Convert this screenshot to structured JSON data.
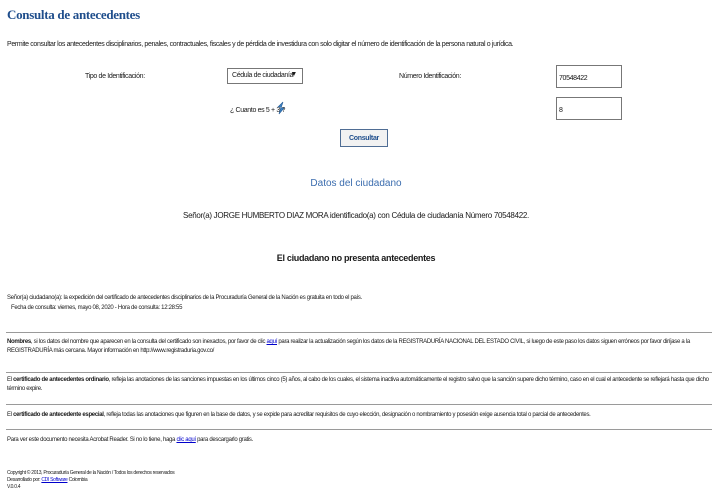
{
  "header": {
    "title": "Consulta de antecedentes",
    "description": "Permite consultar los antecedentes disciplinarios, penales, contractuales, fiscales y de pérdida de investidura con solo digitar el número de identificación de la persona natural o jurídica."
  },
  "form": {
    "tipo_label": "Tipo de Identificación:",
    "tipo_value": "Cédula de ciudadanía",
    "numero_label": "Número Identificación:",
    "numero_value": "70548422",
    "captcha_question": "¿ Cuanto es 5 + 3 ?",
    "captcha_answer": "8",
    "submit_label": "Consultar"
  },
  "result": {
    "section_title": "Datos del ciudadano",
    "citizen_line": "Señor(a)  JORGE HUMBERTO DIAZ MORA identificado(a) con Cédula de ciudadanía Número 70548422.",
    "status": "El ciudadano no presenta antecedentes"
  },
  "notice": {
    "line1": "Señor(a) ciudadano(a): la expedición del certificado de antecedentes disciplinarios de la Procuraduría General de la Nación es gratuita en todo el país.",
    "line2": "Fecha de consulta: viernes, mayo 08, 2020 - Hora de consulta: 12:28:55"
  },
  "info": {
    "nombres_bold": "Nombres",
    "nombres_pre": ", si los datos del nombre que aparecen en la consulta del certificado son inexactos, por favor de clic ",
    "nombres_link": "aquí",
    "nombres_post": " para realizar la actualización según los datos de la REGISTRADURÍA NACIONAL DEL ESTADO CIVIL, si luego de este paso los datos siguen erróneos por favor diríjase a la REGISTRADURÍA más cercana. Mayor información en http://www.registraduria.gov.co/",
    "ordinario_pre": "El ",
    "ordinario_bold": "certificado de antecedentes ordinario",
    "ordinario_post": ", refleja las anotaciones de las sanciones impuestas en los últimos cinco (5) años, al cabo de los cuales, el sistema inactiva automáticamente el registro salvo que la sanción supere dicho término, caso en el cual el antecedente se reflejará hasta que dicho término expire.",
    "especial_pre": "El ",
    "especial_bold": "certificado de antecedente especial",
    "especial_post": ", refleja todas las anotaciones que figuren en la base de datos, y se expide para acreditar requisitos de cuyo elección, designación o nombramiento y posesión exige ausencia total o parcial de antecedentes.",
    "acrobat_pre": "Para ver este documento necesita Acrobat Reader. Si no lo tiene, haga ",
    "acrobat_link": "clic aquí",
    "acrobat_post": " para descargarlo gratis."
  },
  "footer": {
    "copyright": "Copyright © 2013, Procuraduría General de la Nación / Todos los derechos reservados",
    "developed_pre": "Desarrollado por: ",
    "developed_link": "CDI Software",
    "developed_post": " Colombia",
    "version": "V.0.0.4"
  }
}
